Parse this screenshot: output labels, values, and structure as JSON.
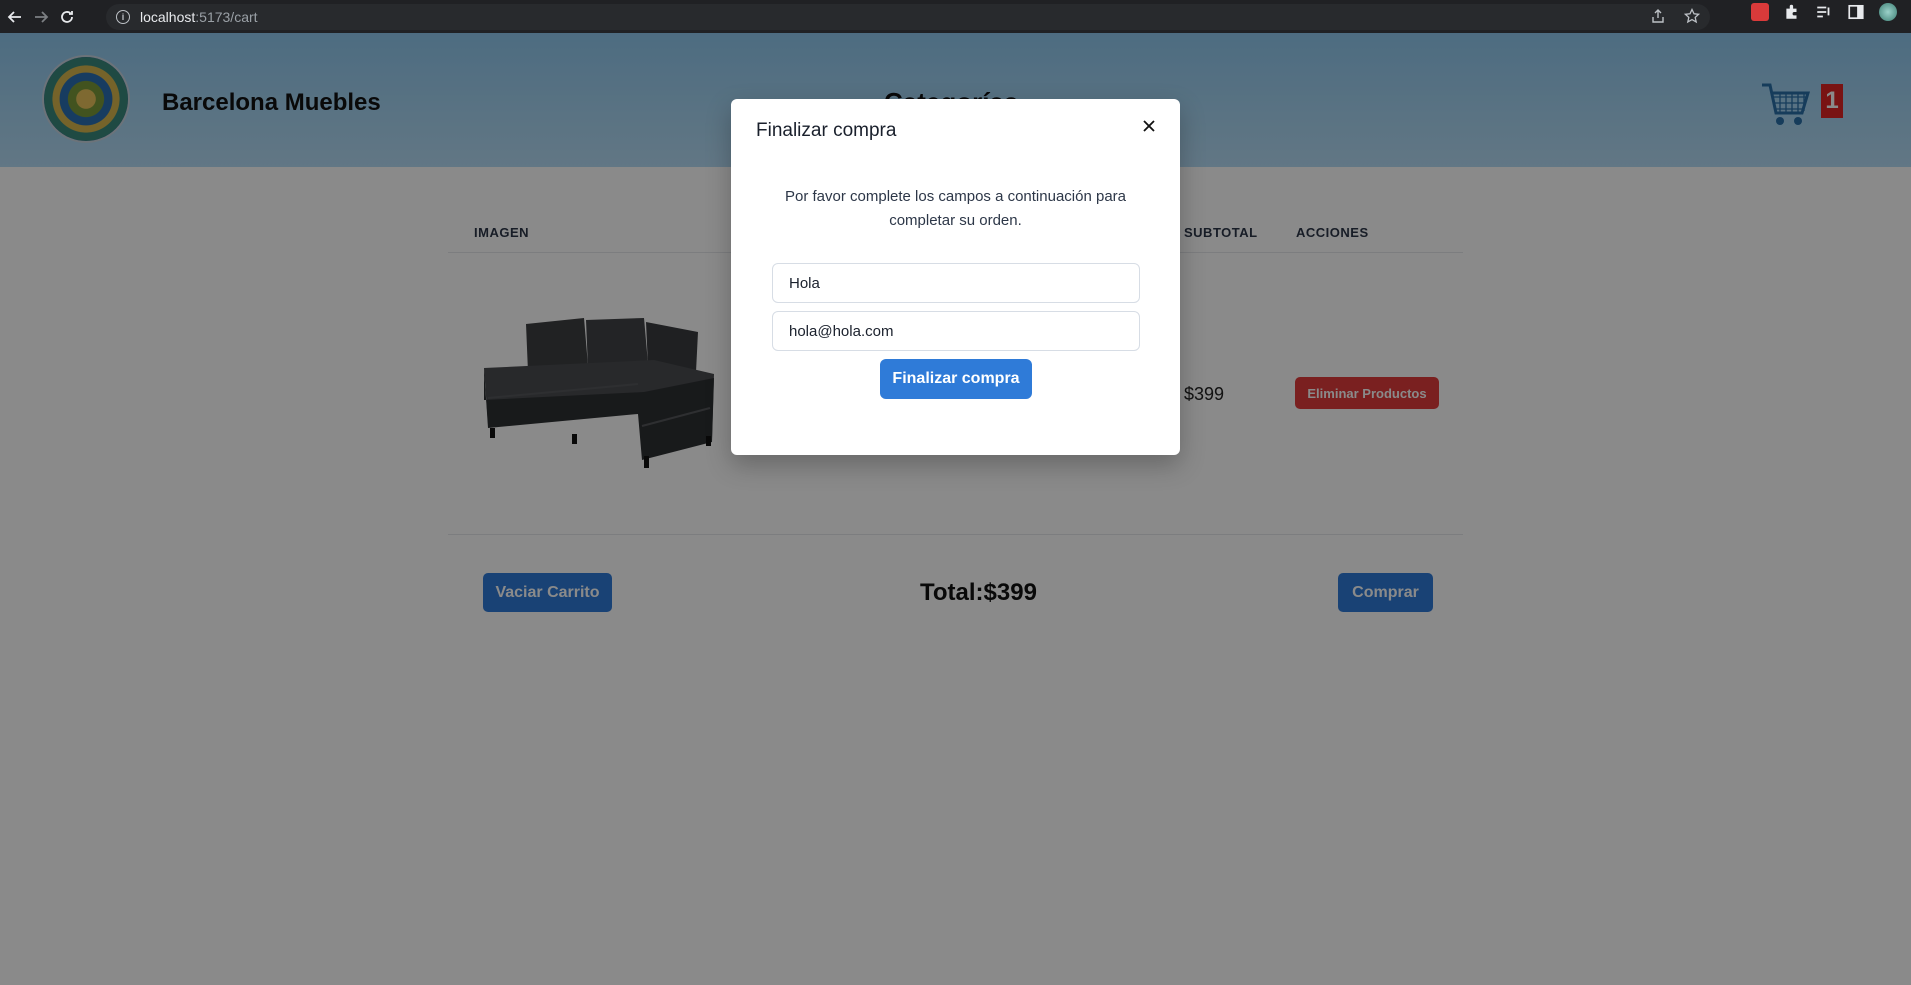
{
  "browser": {
    "url_host": "localhost",
    "url_path": ":5173/cart"
  },
  "header": {
    "brand": "Barcelona Muebles",
    "categories": "Categorías",
    "cart_count": "1"
  },
  "table": {
    "headers": [
      "IMAGEN",
      "SUBTOTAL",
      "ACCIONES"
    ],
    "row": {
      "subtotal": "$399",
      "remove_label": "Eliminar Productos"
    }
  },
  "footer": {
    "empty_label": "Vaciar Carrito",
    "total": "Total:$399",
    "buy_label": "Comprar"
  },
  "modal": {
    "title": "Finalizar compra",
    "text": "Por favor complete los campos a continuación para completar su orden.",
    "name_value": "Hola",
    "email_value": "hola@hola.com",
    "submit_label": "Finalizar compra"
  },
  "colors": {
    "primary": "#2f7bd8",
    "danger": "#e23b3b",
    "header_bg": "#a8d4f1"
  }
}
